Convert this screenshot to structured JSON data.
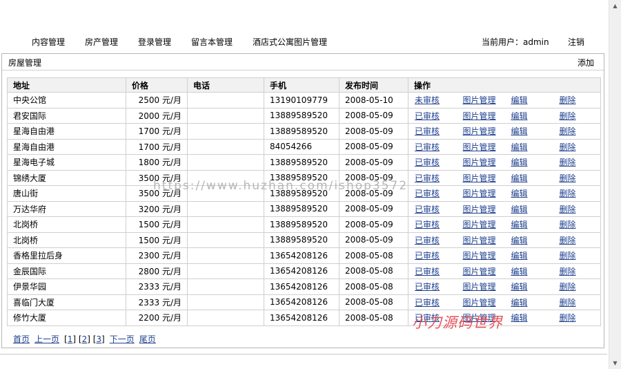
{
  "nav": {
    "items": [
      "内容管理",
      "房产管理",
      "登录管理",
      "留言本管理",
      "酒店式公寓图片管理"
    ],
    "current_user_label": "当前用户：",
    "current_user": "admin",
    "logout": "注销"
  },
  "panel": {
    "title": "房屋管理",
    "add": "添加"
  },
  "table": {
    "headers": [
      "地址",
      "价格",
      "电话",
      "手机",
      "发布时间",
      "操作"
    ],
    "actions": {
      "image": "图片管理",
      "edit": "编辑",
      "delete": "删除"
    },
    "rows": [
      {
        "address": "中央公馆",
        "price": "2500 元/月",
        "phone": "",
        "mobile": "13190109779",
        "date": "2008-05-10",
        "status": "未审核"
      },
      {
        "address": "君安国际",
        "price": "2000 元/月",
        "phone": "",
        "mobile": "13889589520",
        "date": "2008-05-09",
        "status": "已审核"
      },
      {
        "address": "星海自由港",
        "price": "1700 元/月",
        "phone": "",
        "mobile": "13889589520",
        "date": "2008-05-09",
        "status": "已审核"
      },
      {
        "address": "星海自由港",
        "price": "1700 元/月",
        "phone": "",
        "mobile": "84054266",
        "date": "2008-05-09",
        "status": "已审核"
      },
      {
        "address": "星海电子城",
        "price": "1800 元/月",
        "phone": "",
        "mobile": "13889589520",
        "date": "2008-05-09",
        "status": "已审核"
      },
      {
        "address": "锦绣大厦",
        "price": "3500 元/月",
        "phone": "",
        "mobile": "13889589520",
        "date": "2008-05-09",
        "status": "已审核"
      },
      {
        "address": "唐山街",
        "price": "3500 元/月",
        "phone": "",
        "mobile": "13889589520",
        "date": "2008-05-09",
        "status": "已审核"
      },
      {
        "address": "万达华府",
        "price": "3200 元/月",
        "phone": "",
        "mobile": "13889589520",
        "date": "2008-05-09",
        "status": "已审核"
      },
      {
        "address": "北岗桥",
        "price": "1500 元/月",
        "phone": "",
        "mobile": "13889589520",
        "date": "2008-05-09",
        "status": "已审核"
      },
      {
        "address": "北岗桥",
        "price": "1500 元/月",
        "phone": "",
        "mobile": "13889589520",
        "date": "2008-05-09",
        "status": "已审核"
      },
      {
        "address": "香格里拉后身",
        "price": "2300 元/月",
        "phone": "",
        "mobile": "13654208126",
        "date": "2008-05-08",
        "status": "已审核"
      },
      {
        "address": "金辰国际",
        "price": "2800 元/月",
        "phone": "",
        "mobile": "13654208126",
        "date": "2008-05-08",
        "status": "已审核"
      },
      {
        "address": "伊景华园",
        "price": "2333 元/月",
        "phone": "",
        "mobile": "13654208126",
        "date": "2008-05-08",
        "status": "已审核"
      },
      {
        "address": "喜临门大厦",
        "price": "2333 元/月",
        "phone": "",
        "mobile": "13654208126",
        "date": "2008-05-08",
        "status": "已审核"
      },
      {
        "address": "修竹大厦",
        "price": "2200 元/月",
        "phone": "",
        "mobile": "13654208126",
        "date": "2008-05-08",
        "status": "已审核"
      }
    ]
  },
  "pager": {
    "first": "首页",
    "prev": "上一页",
    "pages": [
      "1",
      "2",
      "3"
    ],
    "next": "下一页",
    "last": "尾页"
  },
  "overlays": {
    "watermark": "https://www.huzhan.com/ishop3572",
    "signature": "小刀源码世界"
  },
  "colors": {
    "link": "#1d3f8e",
    "signature": "#e7525b",
    "header_bg": "#f1f1f1"
  }
}
